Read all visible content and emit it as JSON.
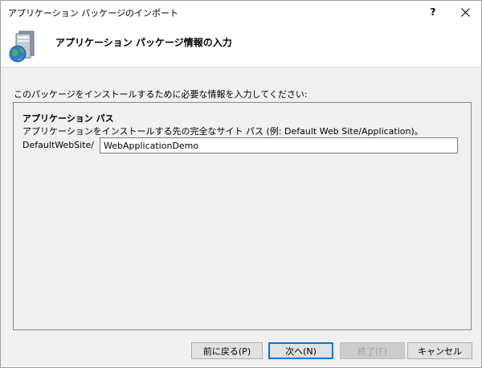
{
  "window": {
    "title": "アプリケーション パッケージのインポート",
    "help_label": "?"
  },
  "header": {
    "title": "アプリケーション パッケージ情報の入力"
  },
  "instruction": "このパッケージをインストールするために必要な情報を入力してください:",
  "section": {
    "title": "アプリケーション パス",
    "description": "アプリケーションをインストールする先の完全なサイト パス (例: Default Web Site/Application)。",
    "path_prefix": "DefaultWebSite/",
    "path_value": "WebApplicationDemo"
  },
  "buttons": {
    "back": "前に戻る(P)",
    "next": "次へ(N)",
    "finish": "終了(F)",
    "cancel": "キャンセル"
  }
}
